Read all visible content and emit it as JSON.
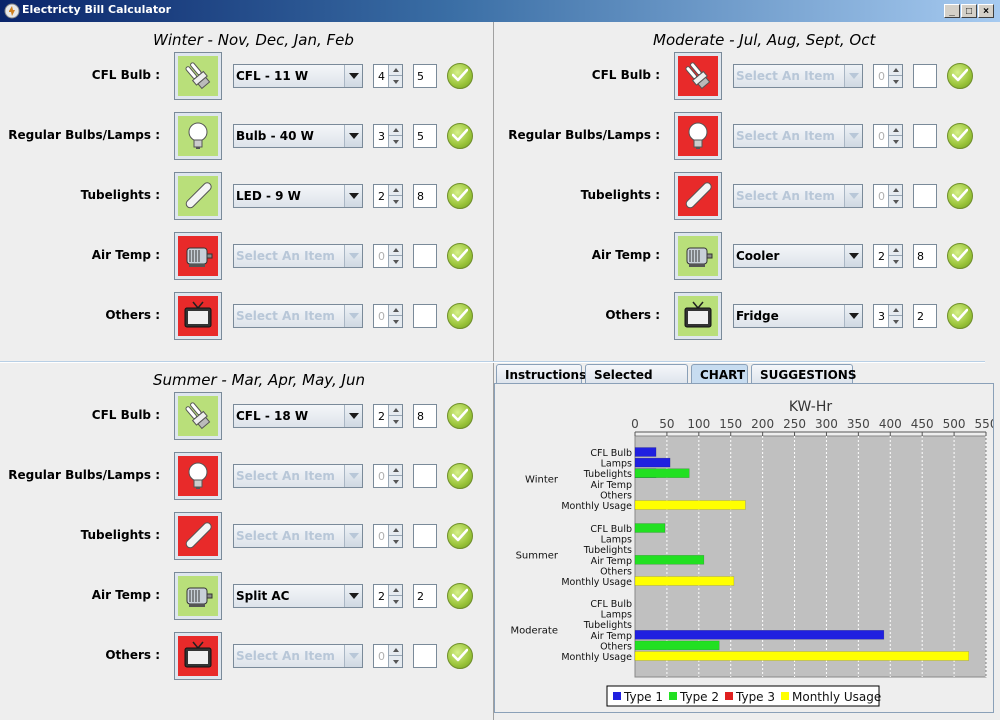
{
  "window": {
    "title": "Electricty Bill Calculator"
  },
  "seasons": [
    {
      "id": "winter",
      "title": "Winter - Nov, Dec, Jan, Feb",
      "rows": [
        {
          "label": "CFL Bulb :",
          "icon": "cfl-bulb-icon",
          "icon_bg": "green",
          "selection": "CFL - 11 W",
          "spinner": "4",
          "qty": "5",
          "enabled": true
        },
        {
          "label": "Regular Bulbs/Lamps :",
          "icon": "bulb-icon",
          "icon_bg": "green",
          "selection": "Bulb - 40 W",
          "spinner": "3",
          "qty": "5",
          "enabled": true
        },
        {
          "label": "Tubelights :",
          "icon": "tubelight-icon",
          "icon_bg": "green",
          "selection": "LED - 9 W",
          "spinner": "2",
          "qty": "8",
          "enabled": true
        },
        {
          "label": "Air Temp :",
          "icon": "motor-icon",
          "icon_bg": "red",
          "selection": "Select An Item",
          "spinner": "0",
          "qty": "",
          "enabled": false
        },
        {
          "label": "Others :",
          "icon": "tv-icon",
          "icon_bg": "red",
          "selection": "Select An Item",
          "spinner": "0",
          "qty": "",
          "enabled": false
        }
      ]
    },
    {
      "id": "moderate",
      "title": "Moderate - Jul, Aug, Sept, Oct",
      "rows": [
        {
          "label": "CFL Bulb :",
          "icon": "cfl-bulb-icon",
          "icon_bg": "red",
          "selection": "Select An Item",
          "spinner": "0",
          "qty": "",
          "enabled": false
        },
        {
          "label": "Regular Bulbs/Lamps :",
          "icon": "bulb-icon",
          "icon_bg": "red",
          "selection": "Select An Item",
          "spinner": "0",
          "qty": "",
          "enabled": false
        },
        {
          "label": "Tubelights :",
          "icon": "tubelight-icon",
          "icon_bg": "red",
          "selection": "Select An Item",
          "spinner": "0",
          "qty": "",
          "enabled": false
        },
        {
          "label": "Air Temp :",
          "icon": "motor-icon",
          "icon_bg": "green",
          "selection": "Cooler",
          "spinner": "2",
          "qty": "8",
          "enabled": true
        },
        {
          "label": "Others :",
          "icon": "tv-icon",
          "icon_bg": "green",
          "selection": "Fridge",
          "spinner": "3",
          "qty": "2",
          "enabled": true
        }
      ]
    },
    {
      "id": "summer",
      "title": "Summer - Mar, Apr, May, Jun",
      "rows": [
        {
          "label": "CFL Bulb :",
          "icon": "cfl-bulb-icon",
          "icon_bg": "green",
          "selection": "CFL - 18 W",
          "spinner": "2",
          "qty": "8",
          "enabled": true
        },
        {
          "label": "Regular Bulbs/Lamps :",
          "icon": "bulb-icon",
          "icon_bg": "red",
          "selection": "Select An Item",
          "spinner": "0",
          "qty": "",
          "enabled": false
        },
        {
          "label": "Tubelights :",
          "icon": "tubelight-icon",
          "icon_bg": "red",
          "selection": "Select An Item",
          "spinner": "0",
          "qty": "",
          "enabled": false
        },
        {
          "label": "Air Temp :",
          "icon": "motor-icon",
          "icon_bg": "green",
          "selection": "Split AC",
          "spinner": "2",
          "qty": "2",
          "enabled": true
        },
        {
          "label": "Others :",
          "icon": "tv-icon",
          "icon_bg": "red",
          "selection": "Select An Item",
          "spinner": "0",
          "qty": "",
          "enabled": false
        }
      ]
    }
  ],
  "tabs": [
    {
      "label": "Instructions",
      "active": false
    },
    {
      "label": "Selected Items",
      "active": false
    },
    {
      "label": "CHART",
      "active": true
    },
    {
      "label": "SUGGESTIONS",
      "active": false
    }
  ],
  "colors": {
    "type1": "#2020e0",
    "type2": "#22e022",
    "type3": "#e02020",
    "monthly": "#ffff00",
    "plot_bg": "#c0c0c0"
  },
  "chart_data": {
    "type": "bar",
    "orientation": "horizontal",
    "title": "KW-Hr",
    "xlim": [
      0,
      550
    ],
    "xticks": [
      0,
      50,
      100,
      150,
      200,
      250,
      300,
      350,
      400,
      450,
      500,
      550
    ],
    "groups": [
      "Winter",
      "Summer",
      "Moderate"
    ],
    "categories": [
      "CFL Bulb",
      "Lamps",
      "Tubelights",
      "Air Temp",
      "Others",
      "Monthly Usage"
    ],
    "series": [
      {
        "name": "Type 1",
        "color": "#2020e0",
        "values": [
          [
            33,
            55,
            33,
            0,
            0,
            0
          ],
          [
            0,
            0,
            0,
            0,
            0,
            0
          ],
          [
            0,
            0,
            0,
            390,
            0,
            0
          ]
        ]
      },
      {
        "name": "Type 2",
        "color": "#22e022",
        "values": [
          [
            0,
            0,
            85,
            0,
            0,
            0
          ],
          [
            47,
            0,
            0,
            108,
            0,
            0
          ],
          [
            0,
            0,
            0,
            0,
            132,
            0
          ]
        ]
      },
      {
        "name": "Type 3",
        "color": "#e02020",
        "values": [
          [
            0,
            0,
            0,
            0,
            0,
            0
          ],
          [
            0,
            0,
            0,
            0,
            0,
            0
          ],
          [
            0,
            0,
            0,
            0,
            0,
            0
          ]
        ]
      },
      {
        "name": "Monthly Usage",
        "color": "#ffff00",
        "values": [
          [
            0,
            0,
            0,
            0,
            0,
            173
          ],
          [
            0,
            0,
            0,
            0,
            0,
            155
          ],
          [
            0,
            0,
            0,
            0,
            0,
            523
          ]
        ]
      }
    ],
    "legend": "bottom"
  }
}
